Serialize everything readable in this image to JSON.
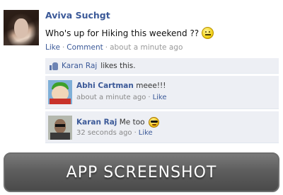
{
  "post": {
    "author": "Aviva Suchgt",
    "status": "Who's up for Hiking this weekend ??",
    "status_emoticon": "smiley-icon",
    "actions": {
      "like": "Like",
      "sep1": "·",
      "comment": "Comment",
      "sep2": "·",
      "time": "about a minute ago"
    }
  },
  "likes": {
    "icon": "thumbs-up-icon",
    "name": "Karan Raj",
    "suffix": "likes this."
  },
  "comments": [
    {
      "author": "Abhi Cartman",
      "text": "meee!!!",
      "time": "about a minute ago",
      "sep": "·",
      "like": "Like"
    },
    {
      "author": "Karan Raj",
      "text": "Me too",
      "emoticon": "cool-smiley-icon",
      "time": "32 seconds ago",
      "sep": "·",
      "like": "Like"
    }
  ],
  "banner": {
    "text": "APP SCREENSHOT"
  },
  "colors": {
    "link": "#3b5998",
    "feedback_bg": "#edeff4",
    "banner_bg": "#5e5e5e"
  }
}
